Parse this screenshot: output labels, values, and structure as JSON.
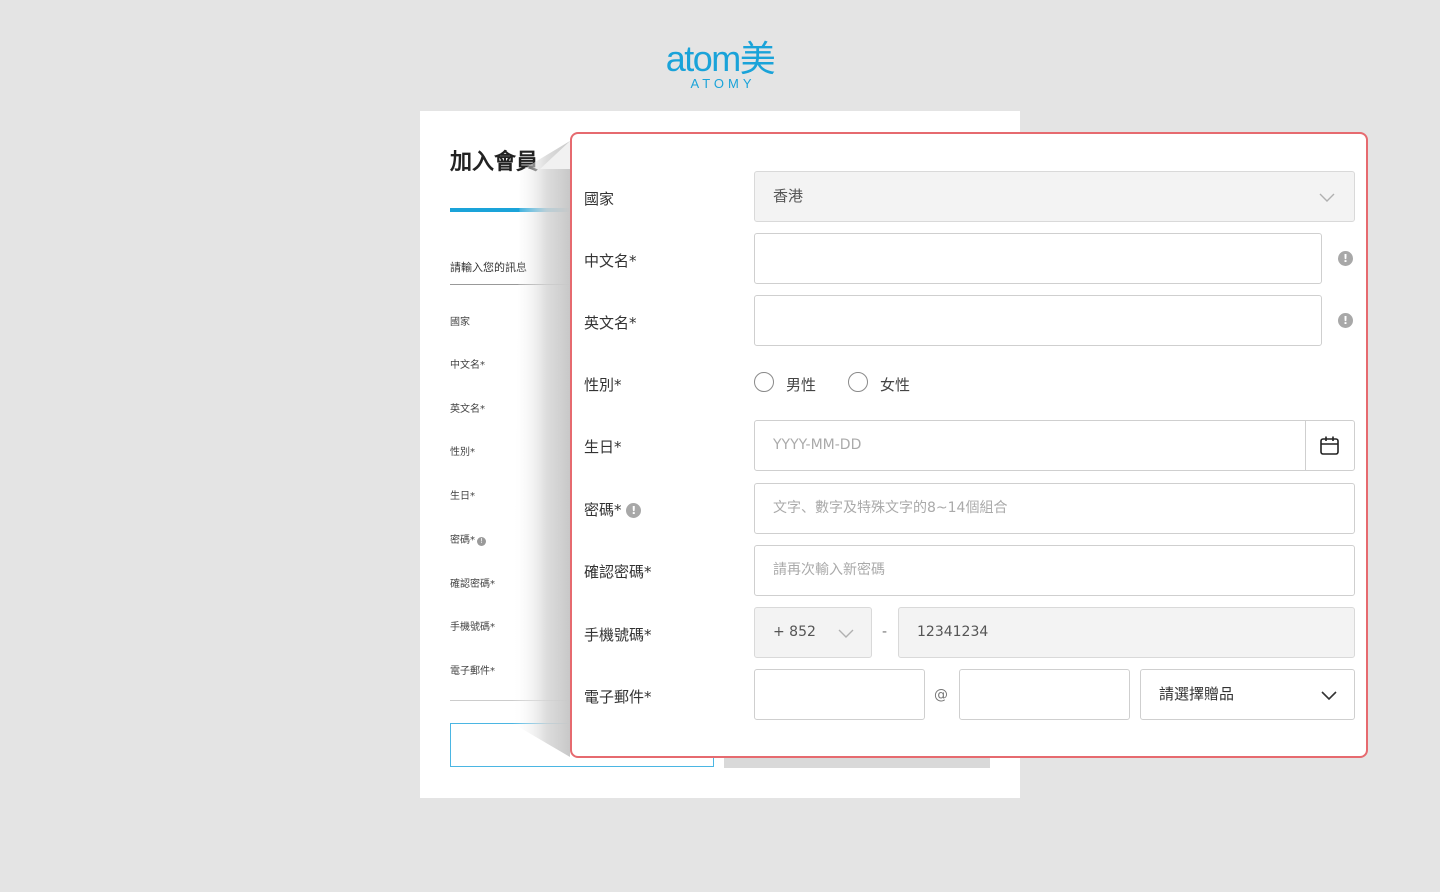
{
  "logo": {
    "main": "atom美",
    "sub": "ATOMY"
  },
  "background_form": {
    "title": "加入會員",
    "subtitle": "請輸入您的訊息",
    "labels": [
      "國家",
      "中文名*",
      "英文名*",
      "性別*",
      "生日*",
      "密碼*",
      "確認密碼*",
      "手機號碼*",
      "電子郵件*"
    ]
  },
  "form": {
    "country": {
      "label": "國家",
      "value": "香港"
    },
    "chinese_name": {
      "label": "中文名*",
      "value": ""
    },
    "english_name": {
      "label": "英文名*",
      "value": ""
    },
    "gender": {
      "label": "性別*",
      "options": [
        "男性",
        "女性"
      ],
      "selected": null
    },
    "birthday": {
      "label": "生日*",
      "placeholder": "YYYY-MM-DD"
    },
    "password": {
      "label": "密碼*",
      "placeholder": "文字、數字及特殊文字的8~14個組合"
    },
    "confirm_password": {
      "label": "確認密碼*",
      "placeholder": "請再次輸入新密碼"
    },
    "mobile": {
      "label": "手機號碼*",
      "code": "+ 852",
      "separator": "-",
      "number": "12341234"
    },
    "email": {
      "label": "電子郵件*",
      "at": "@",
      "domain_select": "請選擇贈品"
    }
  },
  "icons": {
    "info": "!",
    "chevron": "chevron-down-icon",
    "calendar": "calendar-icon"
  },
  "colors": {
    "brand": "#1aa3d9",
    "highlight_border": "#e66a6f"
  }
}
